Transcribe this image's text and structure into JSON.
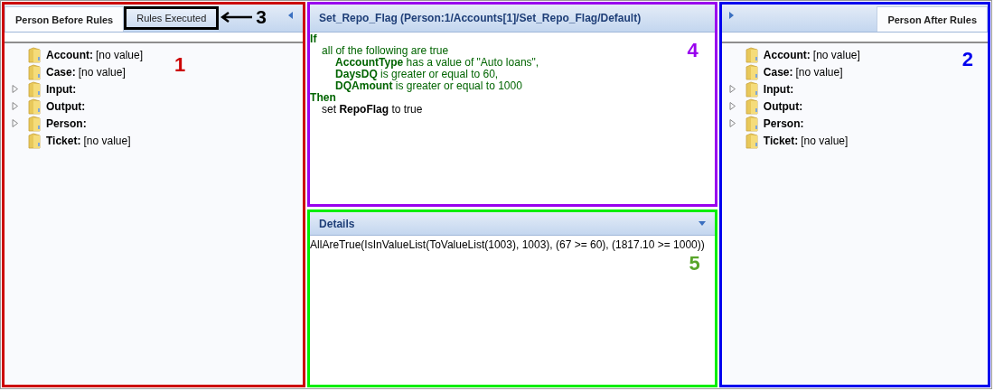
{
  "left_panel": {
    "tabs": [
      {
        "label": "Person Before Rules",
        "selected": true,
        "highlighted": false
      },
      {
        "label": "Rules Executed",
        "selected": false,
        "highlighted": true
      }
    ],
    "annotation": "1",
    "tab_callout": "3",
    "tree": [
      {
        "name": "Account:",
        "value": "[no value]",
        "expandable": false
      },
      {
        "name": "Case:",
        "value": "[no value]",
        "expandable": false
      },
      {
        "name": "Input:",
        "expandable": true
      },
      {
        "name": "Output:",
        "expandable": true
      },
      {
        "name": "Person:",
        "expandable": true
      },
      {
        "name": "Ticket:",
        "value": "[no value]",
        "expandable": false
      }
    ]
  },
  "rule_panel": {
    "title": "Set_Repo_Flag (Person:1/Accounts[1]/Set_Repo_Flag/Default)",
    "annotation": "4",
    "lines": [
      {
        "kind": "keyword",
        "text": "If"
      },
      {
        "kind": "group",
        "text": "all of the following are true"
      },
      {
        "kind": "condition",
        "text": "**AccountType** has a value of \"Auto loans\","
      },
      {
        "kind": "condition",
        "text": "**DaysDQ** is greater or equal to 60,"
      },
      {
        "kind": "condition",
        "text": "**DQAmount** is greater or equal to 1000"
      },
      {
        "kind": "keyword",
        "text": "Then"
      },
      {
        "kind": "action",
        "text": "set **RepoFlag** to true"
      }
    ]
  },
  "details_panel": {
    "title": "Details",
    "annotation": "5",
    "text": "AllAreTrue(IsInValueList(ToValueList(1003), 1003), (67 >= 60), (1817.10 >= 1000))"
  },
  "right_panel": {
    "tabs": [
      {
        "label": "Person After Rules",
        "selected": true
      }
    ],
    "annotation": "2",
    "tree": [
      {
        "name": "Account:",
        "value": "[no value]",
        "expandable": false
      },
      {
        "name": "Case:",
        "value": "[no value]",
        "expandable": false
      },
      {
        "name": "Input:",
        "expandable": true
      },
      {
        "name": "Output:",
        "expandable": true
      },
      {
        "name": "Person:",
        "expandable": true
      },
      {
        "name": "Ticket:",
        "value": "[no value]",
        "expandable": false
      }
    ]
  }
}
